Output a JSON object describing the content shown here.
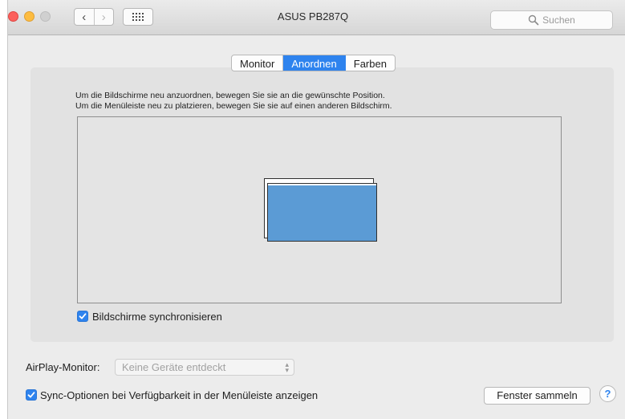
{
  "window": {
    "title": "ASUS PB287Q",
    "nav": {
      "back_glyph": "‹",
      "forward_glyph": "›"
    }
  },
  "search": {
    "placeholder": "Suchen",
    "icon": "search-icon"
  },
  "tabs": [
    {
      "label": "Monitor",
      "active": false
    },
    {
      "label": "Anordnen",
      "active": true
    },
    {
      "label": "Farben",
      "active": false
    }
  ],
  "instructions": {
    "line1": "Um die Bildschirme neu anzuordnen, bewegen Sie sie an die gewünschte Position.",
    "line2": "Um die Menüleiste neu zu platzieren, bewegen Sie sie auf einen anderen Bildschirm."
  },
  "mirror": {
    "label": "Bildschirme synchronisieren",
    "checked": true
  },
  "airplay": {
    "label": "AirPlay-Monitor:",
    "value": "Keine Geräte entdeckt"
  },
  "sync_options": {
    "label": "Sync-Optionen bei Verfügbarkeit in der Menüleiste anzeigen",
    "checked": true
  },
  "buttons": {
    "gather": "Fenster sammeln",
    "help": "?"
  },
  "colors": {
    "accent": "#2e83ee",
    "display": "#5b9bd5",
    "close": "#fc605c",
    "minimize": "#fdbc40"
  }
}
